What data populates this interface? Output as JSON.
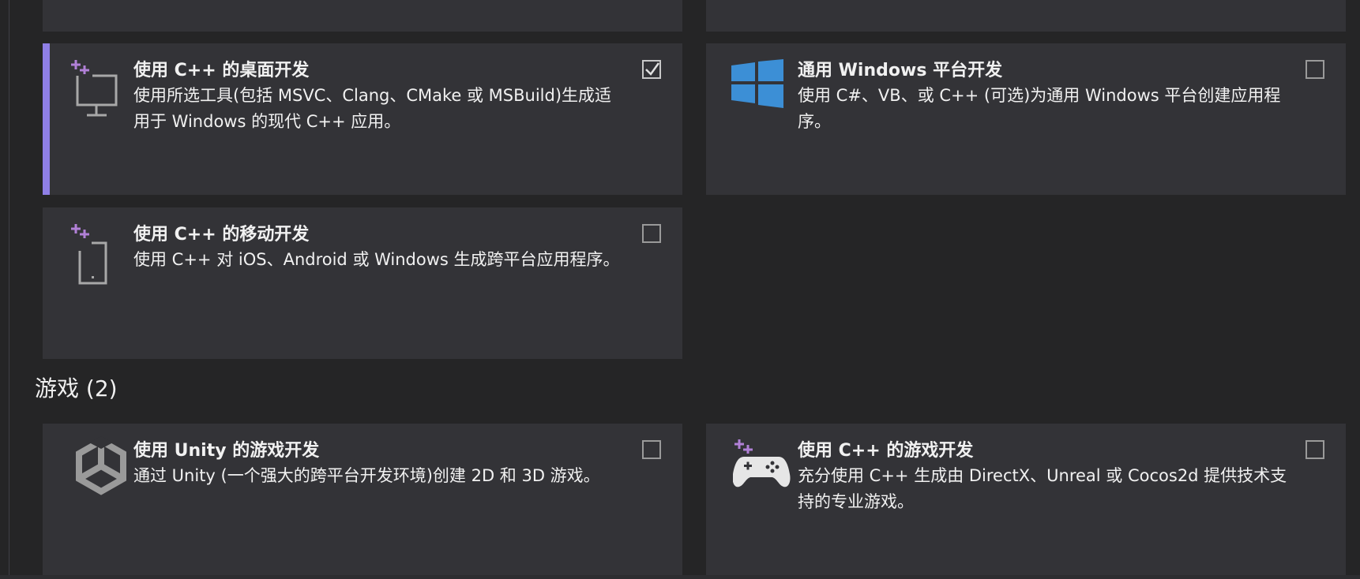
{
  "workloads_group_1": [
    {
      "id": "cpp-desktop",
      "title": "使用 C++ 的桌面开发",
      "description": "使用所选工具(包括 MSVC、Clang、CMake 或 MSBuild)生成适用于 Windows 的现代 C++ 应用。",
      "checked": true,
      "icon": "monitor-plus-icon"
    },
    {
      "id": "uwp",
      "title": "通用 Windows 平台开发",
      "description": "使用 C#、VB、或 C++ (可选)为通用 Windows 平台创建应用程序。",
      "checked": false,
      "icon": "windows-logo-icon"
    },
    {
      "id": "cpp-mobile",
      "title": "使用 C++ 的移动开发",
      "description": "使用 C++ 对 iOS、Android 或 Windows 生成跨平台应用程序。",
      "checked": false,
      "icon": "phone-plus-icon"
    }
  ],
  "games_section": {
    "title": "游戏 (2)"
  },
  "workloads_games": [
    {
      "id": "unity",
      "title": "使用 Unity 的游戏开发",
      "description": "通过 Unity (一个强大的跨平台开发环境)创建 2D 和 3D 游戏。",
      "checked": false,
      "icon": "unity-logo-icon"
    },
    {
      "id": "cpp-games",
      "title": "使用 C++ 的游戏开发",
      "description": "充分使用 C++ 生成由 DirectX、Unreal 或 Cocos2d 提供技术支持的专业游戏。",
      "checked": false,
      "icon": "gamepad-plus-icon"
    }
  ],
  "colors": {
    "accent": "#8f7fe6",
    "plus": "#b180d7",
    "windows_blue": "#3c8fd6",
    "card_bg": "#333337",
    "page_bg": "#252526"
  }
}
